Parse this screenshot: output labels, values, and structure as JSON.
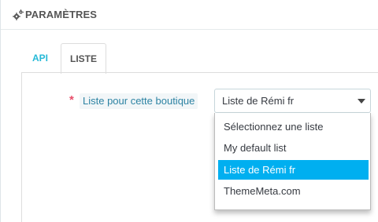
{
  "panel": {
    "title": "PARAMÈTRES",
    "icon": "gears-icon"
  },
  "tabs": [
    {
      "label": "API",
      "active": false
    },
    {
      "label": "LISTE",
      "active": true
    }
  ],
  "form": {
    "required_mark": "*",
    "field_label": "Liste pour cette boutique",
    "select": {
      "value": "Liste de Rémi fr",
      "open": true,
      "options": [
        {
          "label": "Sélectionnez une liste",
          "selected": false
        },
        {
          "label": "My default list",
          "selected": false
        },
        {
          "label": "Liste de Rémi fr",
          "selected": true
        },
        {
          "label": "ThemeMeta.com",
          "selected": false
        }
      ]
    }
  },
  "colors": {
    "accent": "#25b9d7",
    "selected_bg": "#00aff0",
    "required": "#e84e6a",
    "label_text": "#2d83a3"
  }
}
